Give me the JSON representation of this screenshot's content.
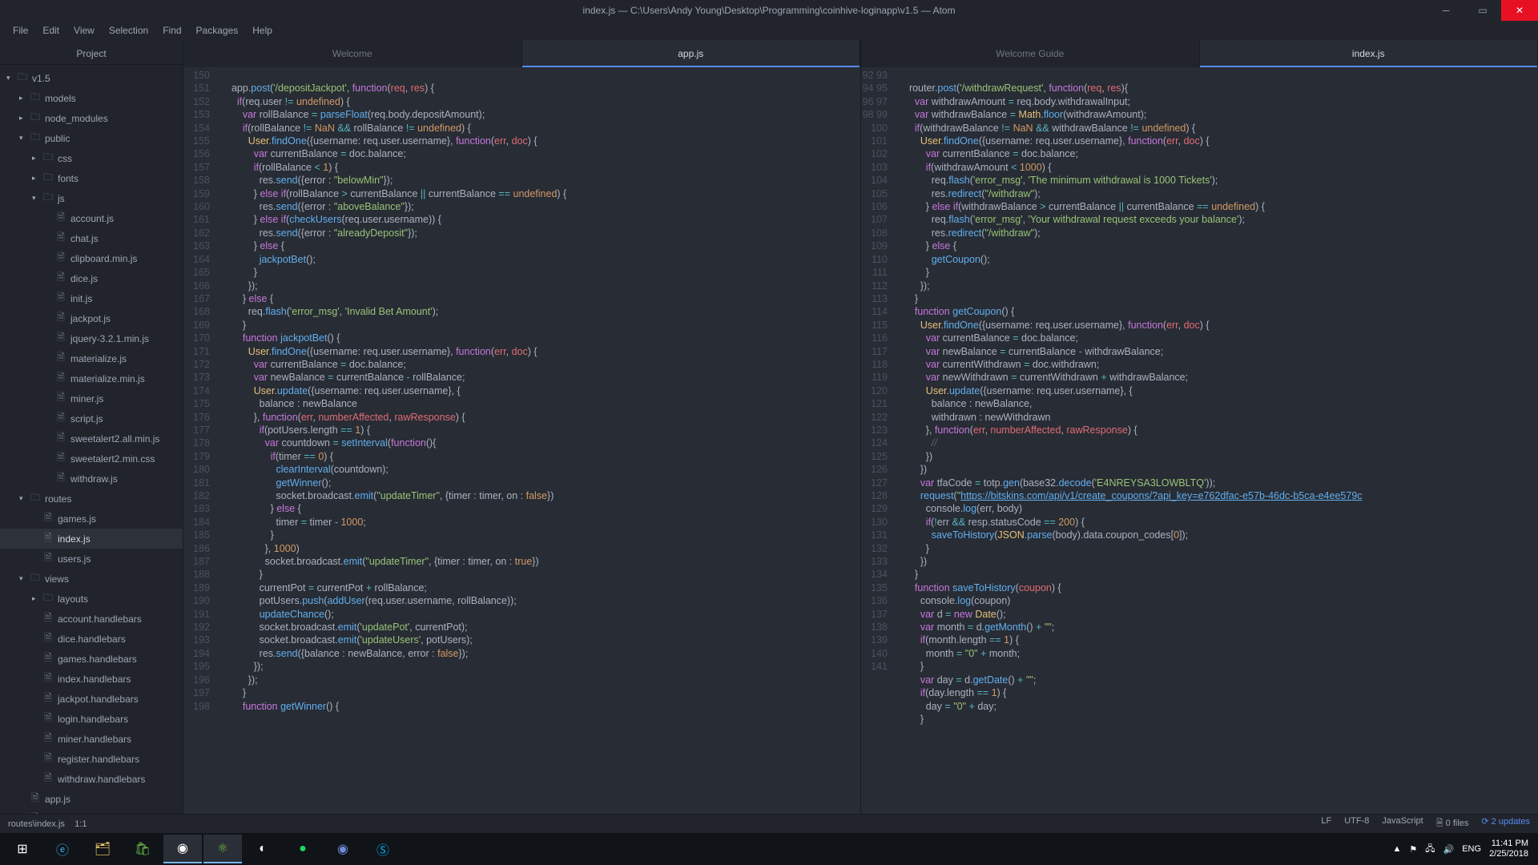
{
  "title": "index.js — C:\\Users\\Andy Young\\Desktop\\Programming\\coinhive-loginapp\\v1.5 — Atom",
  "menu": [
    "File",
    "Edit",
    "View",
    "Selection",
    "Find",
    "Packages",
    "Help"
  ],
  "sidebar_header": "Project",
  "tree": [
    {
      "d": 0,
      "t": "folder-open",
      "c": "▾",
      "l": "v1.5"
    },
    {
      "d": 1,
      "t": "folder",
      "c": "▸",
      "l": "models"
    },
    {
      "d": 1,
      "t": "folder",
      "c": "▸",
      "l": "node_modules"
    },
    {
      "d": 1,
      "t": "folder-open",
      "c": "▾",
      "l": "public"
    },
    {
      "d": 2,
      "t": "folder",
      "c": "▸",
      "l": "css"
    },
    {
      "d": 2,
      "t": "folder",
      "c": "▸",
      "l": "fonts"
    },
    {
      "d": 2,
      "t": "folder-open",
      "c": "▾",
      "l": "js"
    },
    {
      "d": 3,
      "t": "file",
      "l": "account.js"
    },
    {
      "d": 3,
      "t": "file",
      "l": "chat.js"
    },
    {
      "d": 3,
      "t": "file",
      "l": "clipboard.min.js"
    },
    {
      "d": 3,
      "t": "file",
      "l": "dice.js"
    },
    {
      "d": 3,
      "t": "file",
      "l": "init.js"
    },
    {
      "d": 3,
      "t": "file",
      "l": "jackpot.js"
    },
    {
      "d": 3,
      "t": "file",
      "l": "jquery-3.2.1.min.js"
    },
    {
      "d": 3,
      "t": "file",
      "l": "materialize.js"
    },
    {
      "d": 3,
      "t": "file",
      "l": "materialize.min.js"
    },
    {
      "d": 3,
      "t": "file",
      "l": "miner.js"
    },
    {
      "d": 3,
      "t": "file",
      "l": "script.js"
    },
    {
      "d": 3,
      "t": "file",
      "l": "sweetalert2.all.min.js"
    },
    {
      "d": 3,
      "t": "file",
      "l": "sweetalert2.min.css"
    },
    {
      "d": 3,
      "t": "file",
      "l": "withdraw.js"
    },
    {
      "d": 1,
      "t": "folder-open",
      "c": "▾",
      "l": "routes"
    },
    {
      "d": 2,
      "t": "file",
      "l": "games.js"
    },
    {
      "d": 2,
      "t": "file",
      "l": "index.js",
      "sel": true
    },
    {
      "d": 2,
      "t": "file",
      "l": "users.js"
    },
    {
      "d": 1,
      "t": "folder-open",
      "c": "▾",
      "l": "views"
    },
    {
      "d": 2,
      "t": "folder",
      "c": "▸",
      "l": "layouts"
    },
    {
      "d": 2,
      "t": "file",
      "l": "account.handlebars"
    },
    {
      "d": 2,
      "t": "file",
      "l": "dice.handlebars"
    },
    {
      "d": 2,
      "t": "file",
      "l": "games.handlebars"
    },
    {
      "d": 2,
      "t": "file",
      "l": "index.handlebars"
    },
    {
      "d": 2,
      "t": "file",
      "l": "jackpot.handlebars"
    },
    {
      "d": 2,
      "t": "file",
      "l": "login.handlebars"
    },
    {
      "d": 2,
      "t": "file",
      "l": "miner.handlebars"
    },
    {
      "d": 2,
      "t": "file",
      "l": "register.handlebars"
    },
    {
      "d": 2,
      "t": "file",
      "l": "withdraw.handlebars"
    },
    {
      "d": 1,
      "t": "file",
      "l": "app.js"
    },
    {
      "d": 1,
      "t": "file",
      "l": "package.json"
    }
  ],
  "pane1": {
    "tabs": [
      {
        "l": "Welcome",
        "a": false
      },
      {
        "l": "app.js",
        "a": true
      }
    ],
    "start": 150,
    "code": [
      "",
      "  app<span class='p'>.</span><span class='f'>post</span>(<span class='s'>'/depositJackpot'</span>, <span class='k'>function</span>(<span class='r'>req</span>, <span class='r'>res</span>) {",
      "    <span class='k'>if</span>(req<span class='p'>.</span>user <span class='o'>!=</span> <span class='n'>undefined</span>) {",
      "      <span class='k'>var</span> rollBalance <span class='o'>=</span> <span class='f'>parseFloat</span>(req<span class='p'>.</span>body<span class='p'>.</span>depositAmount);",
      "      <span class='k'>if</span>(rollBalance <span class='o'>!=</span> <span class='n'>NaN</span> <span class='o'>&amp;&amp;</span> rollBalance <span class='o'>!=</span> <span class='n'>undefined</span>) {",
      "        <span class='y'>User</span><span class='p'>.</span><span class='f'>findOne</span>({username<span class='p'>:</span> req<span class='p'>.</span>user<span class='p'>.</span>username}, <span class='k'>function</span>(<span class='r'>err</span>, <span class='r'>doc</span>) {",
      "          <span class='k'>var</span> currentBalance <span class='o'>=</span> doc<span class='p'>.</span>balance;",
      "          <span class='k'>if</span>(rollBalance <span class='o'>&lt;</span> <span class='n'>1</span>) {",
      "            res<span class='p'>.</span><span class='f'>send</span>({error <span class='p'>:</span> <span class='s'>\"belowMin\"</span>});",
      "          } <span class='k'>else if</span>(rollBalance <span class='o'>&gt;</span> currentBalance <span class='o'>||</span> currentBalance <span class='o'>==</span> <span class='n'>undefined</span>) {",
      "            res<span class='p'>.</span><span class='f'>send</span>({error <span class='p'>:</span> <span class='s'>\"aboveBalance\"</span>});",
      "          } <span class='k'>else if</span>(<span class='f'>checkUsers</span>(req<span class='p'>.</span>user<span class='p'>.</span>username)) {",
      "            res<span class='p'>.</span><span class='f'>send</span>({error <span class='p'>:</span> <span class='s'>\"alreadyDeposit\"</span>});",
      "          } <span class='k'>else</span> {",
      "            <span class='f'>jackpotBet</span>();",
      "          }",
      "        });",
      "      } <span class='k'>else</span> {",
      "        req<span class='p'>.</span><span class='f'>flash</span>(<span class='s'>'error_msg'</span>, <span class='s'>'Invalid Bet Amount'</span>);",
      "      }",
      "      <span class='k'>function</span> <span class='f'>jackpotBet</span>() {",
      "        <span class='y'>User</span><span class='p'>.</span><span class='f'>findOne</span>({username<span class='p'>:</span> req<span class='p'>.</span>user<span class='p'>.</span>username}, <span class='k'>function</span>(<span class='r'>err</span>, <span class='r'>doc</span>) {",
      "          <span class='k'>var</span> currentBalance <span class='o'>=</span> doc<span class='p'>.</span>balance;",
      "          <span class='k'>var</span> newBalance <span class='o'>=</span> currentBalance <span class='o'>-</span> rollBalance;",
      "          <span class='y'>User</span><span class='p'>.</span><span class='f'>update</span>({username<span class='p'>:</span> req<span class='p'>.</span>user<span class='p'>.</span>username}, {",
      "            balance <span class='p'>:</span> newBalance",
      "          }, <span class='k'>function</span>(<span class='r'>err</span>, <span class='r'>numberAffected</span>, <span class='r'>rawResponse</span>) {",
      "            <span class='k'>if</span>(potUsers<span class='p'>.</span>length <span class='o'>==</span> <span class='n'>1</span>) {",
      "              <span class='k'>var</span> countdown <span class='o'>=</span> <span class='f'>setInterval</span>(<span class='k'>function</span>(){",
      "                <span class='k'>if</span>(timer <span class='o'>==</span> <span class='n'>0</span>) {",
      "                  <span class='f'>clearInterval</span>(countdown);",
      "                  <span class='f'>getWinner</span>();",
      "                  socket<span class='p'>.</span>broadcast<span class='p'>.</span><span class='f'>emit</span>(<span class='s'>\"updateTimer\"</span>, {timer <span class='p'>:</span> timer, on <span class='p'>:</span> <span class='n'>false</span>})",
      "                } <span class='k'>else</span> {",
      "                  timer <span class='o'>=</span> timer <span class='o'>-</span> <span class='n'>1000</span>;",
      "                }",
      "              }, <span class='n'>1000</span>)",
      "              socket<span class='p'>.</span>broadcast<span class='p'>.</span><span class='f'>emit</span>(<span class='s'>\"updateTimer\"</span>, {timer <span class='p'>:</span> timer, on <span class='p'>:</span> <span class='n'>true</span>})",
      "            }",
      "            currentPot <span class='o'>=</span> currentPot <span class='o'>+</span> rollBalance;",
      "            potUsers<span class='p'>.</span><span class='f'>push</span>(<span class='f'>addUser</span>(req<span class='p'>.</span>user<span class='p'>.</span>username, rollBalance));",
      "            <span class='f'>updateChance</span>();",
      "            socket<span class='p'>.</span>broadcast<span class='p'>.</span><span class='f'>emit</span>(<span class='s'>'updatePot'</span>, currentPot);",
      "            socket<span class='p'>.</span>broadcast<span class='p'>.</span><span class='f'>emit</span>(<span class='s'>'updateUsers'</span>, potUsers);",
      "            res<span class='p'>.</span><span class='f'>send</span>({balance <span class='p'>:</span> newBalance, error <span class='p'>:</span> <span class='n'>false</span>});",
      "          });",
      "        });",
      "      }",
      "      <span class='k'>function</span> <span class='f'>getWinner</span>() {"
    ]
  },
  "pane2": {
    "tabs": [
      {
        "l": "Welcome Guide",
        "a": false
      },
      {
        "l": "index.js",
        "a": true
      }
    ],
    "start": 92,
    "code": [
      "",
      "  router<span class='p'>.</span><span class='f'>post</span>(<span class='s'>'/withdrawRequest'</span>, <span class='k'>function</span>(<span class='r'>req</span>, <span class='r'>res</span>){",
      "    <span class='k'>var</span> withdrawAmount <span class='o'>=</span> req<span class='p'>.</span>body<span class='p'>.</span>withdrawalInput;",
      "    <span class='k'>var</span> withdrawBalance <span class='o'>=</span> <span class='y'>Math</span><span class='p'>.</span><span class='f'>floor</span>(withdrawAmount);",
      "    <span class='k'>if</span>(withdrawBalance <span class='o'>!=</span> <span class='n'>NaN</span> <span class='o'>&amp;&amp;</span> withdrawBalance <span class='o'>!=</span> <span class='n'>undefined</span>) {",
      "      <span class='y'>User</span><span class='p'>.</span><span class='f'>findOne</span>({username<span class='p'>:</span> req<span class='p'>.</span>user<span class='p'>.</span>username}, <span class='k'>function</span>(<span class='r'>err</span>, <span class='r'>doc</span>) {",
      "        <span class='k'>var</span> currentBalance <span class='o'>=</span> doc<span class='p'>.</span>balance;",
      "        <span class='k'>if</span>(withdrawAmount <span class='o'>&lt;</span> <span class='n'>1000</span>) {",
      "          req<span class='p'>.</span><span class='f'>flash</span>(<span class='s'>'error_msg'</span>, <span class='s'>'The minimum withdrawal is 1000 Tickets'</span>);",
      "          res<span class='p'>.</span><span class='f'>redirect</span>(<span class='s'>\"/withdraw\"</span>);",
      "        } <span class='k'>else if</span>(withdrawBalance <span class='o'>&gt;</span> currentBalance <span class='o'>||</span> currentBalance <span class='o'>==</span> <span class='n'>undefined</span>) {",
      "          req<span class='p'>.</span><span class='f'>flash</span>(<span class='s'>'error_msg'</span>, <span class='s'>'Your withdrawal request exceeds your balance'</span>);",
      "          res<span class='p'>.</span><span class='f'>redirect</span>(<span class='s'>\"/withdraw\"</span>);",
      "        } <span class='k'>else</span> {",
      "          <span class='f'>getCoupon</span>();",
      "        }",
      "      });",
      "    }",
      "    <span class='k'>function</span> <span class='f'>getCoupon</span>() {",
      "      <span class='y'>User</span><span class='p'>.</span><span class='f'>findOne</span>({username<span class='p'>:</span> req<span class='p'>.</span>user<span class='p'>.</span>username}, <span class='k'>function</span>(<span class='r'>err</span>, <span class='r'>doc</span>) {",
      "        <span class='k'>var</span> currentBalance <span class='o'>=</span> doc<span class='p'>.</span>balance;",
      "        <span class='k'>var</span> newBalance <span class='o'>=</span> currentBalance <span class='o'>-</span> withdrawBalance;",
      "        <span class='k'>var</span> currentWithdrawn <span class='o'>=</span> doc<span class='p'>.</span>withdrawn;",
      "        <span class='k'>var</span> newWithdrawn <span class='o'>=</span> currentWithdrawn <span class='o'>+</span> withdrawBalance;",
      "        <span class='y'>User</span><span class='p'>.</span><span class='f'>update</span>({username<span class='p'>:</span> req<span class='p'>.</span>user<span class='p'>.</span>username}, {",
      "          balance <span class='p'>:</span> newBalance,",
      "          withdrawn <span class='p'>:</span> newWithdrawn",
      "        }, <span class='k'>function</span>(<span class='r'>err</span>, <span class='r'>numberAffected</span>, <span class='r'>rawResponse</span>) {",
      "          <span class='c'>//</span>",
      "        })",
      "      })",
      "      <span class='k'>var</span> tfaCode <span class='o'>=</span> totp<span class='p'>.</span><span class='f'>gen</span>(base32<span class='p'>.</span><span class='f'>decode</span>(<span class='s'>'E4NREYSA3LOWBLTQ'</span>));",
      "      <span class='f'>request</span>(<span class='s'>\"</span><span class='u'>https://bitskins.com/api/v1/create_coupons/?api_key=e762dfac-e57b-46dc-b5ca-e4ee579c</span>",
      "        console<span class='p'>.</span><span class='f'>log</span>(err, body)",
      "        <span class='k'>if</span>(<span class='o'>!</span>err <span class='o'>&amp;&amp;</span> resp<span class='p'>.</span>statusCode <span class='o'>==</span> <span class='n'>200</span>) {",
      "          <span class='f'>saveToHistory</span>(<span class='y'>JSON</span><span class='p'>.</span><span class='f'>parse</span>(body)<span class='p'>.</span>data<span class='p'>.</span>coupon_codes[<span class='n'>0</span>]);",
      "        }",
      "      })",
      "    }",
      "    <span class='k'>function</span> <span class='f'>saveToHistory</span>(<span class='r'>coupon</span>) {",
      "      console<span class='p'>.</span><span class='f'>log</span>(coupon)",
      "      <span class='k'>var</span> d <span class='o'>=</span> <span class='k'>new</span> <span class='y'>Date</span>();",
      "      <span class='k'>var</span> month <span class='o'>=</span> d<span class='p'>.</span><span class='f'>getMonth</span>() <span class='o'>+</span> <span class='s'>\"\"</span>;",
      "      <span class='k'>if</span>(month<span class='p'>.</span>length <span class='o'>==</span> <span class='n'>1</span>) {",
      "        month <span class='o'>=</span> <span class='s'>\"0\"</span> <span class='o'>+</span> month;",
      "      }",
      "      <span class='k'>var</span> day <span class='o'>=</span> d<span class='p'>.</span><span class='f'>getDate</span>() <span class='o'>+</span> <span class='s'>\"\"</span>;",
      "      <span class='k'>if</span>(day<span class='p'>.</span>length <span class='o'>==</span> <span class='n'>1</span>) {",
      "        day <span class='o'>=</span> <span class='s'>\"0\"</span> <span class='o'>+</span> day;",
      "      }"
    ]
  },
  "status": {
    "file": "routes\\index.js",
    "pos": "1:1",
    "lf": "LF",
    "enc": "UTF-8",
    "lang": "JavaScript",
    "files": "0 files",
    "updates": "2 updates"
  },
  "taskbar": {
    "time": "11:41 PM",
    "date": "2/25/2018",
    "lang": "ENG"
  }
}
